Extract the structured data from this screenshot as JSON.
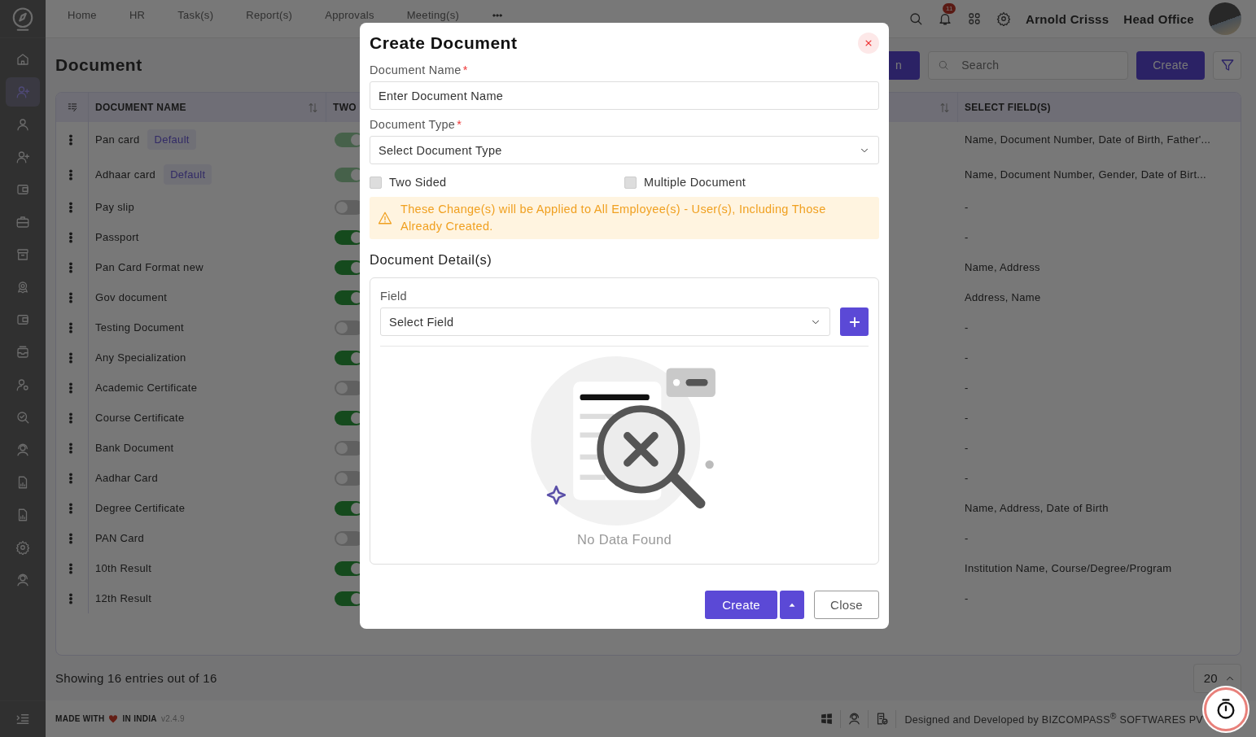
{
  "sidebar": {
    "items": [
      {
        "selected": false
      },
      {
        "selected": true
      },
      {
        "selected": false
      },
      {
        "selected": false
      },
      {
        "selected": false
      },
      {
        "selected": false
      },
      {
        "selected": false
      },
      {
        "selected": false
      },
      {
        "selected": false
      },
      {
        "selected": false
      },
      {
        "selected": false
      },
      {
        "selected": false
      },
      {
        "selected": false
      },
      {
        "selected": false
      },
      {
        "selected": false
      },
      {
        "selected": false
      }
    ]
  },
  "topbar": {
    "nav": [
      "Home",
      "HR",
      "Task(s)",
      "Report(s)",
      "Approvals",
      "Meeting(s)"
    ],
    "notification_count": "11",
    "user_name": "Arnold Crisss",
    "office": "Head Office"
  },
  "page": {
    "title": "Document",
    "partial_button": "n",
    "search_placeholder": "Search",
    "create_button": "Create"
  },
  "table": {
    "columns": [
      "DOCUMENT NAME",
      "TWO",
      "SELECT FIELD(S)"
    ],
    "rows": [
      {
        "name": "Pan card",
        "tag": "Default",
        "on": true,
        "disabled": true,
        "fields": "Name, Document Number, Date of Birth, Father'..."
      },
      {
        "name": "Adhaar card",
        "tag": "Default",
        "on": true,
        "disabled": true,
        "fields": "Name, Document Number, Gender, Date of Birt..."
      },
      {
        "name": "Pay slip",
        "on": false,
        "disabled": false,
        "fields": "-"
      },
      {
        "name": "Passport",
        "on": true,
        "disabled": false,
        "fields": "-"
      },
      {
        "name": "Pan Card Format new",
        "on": true,
        "disabled": false,
        "fields": "Name, Address"
      },
      {
        "name": "Gov document",
        "on": true,
        "disabled": false,
        "fields": "Address, Name"
      },
      {
        "name": "Testing Document",
        "on": false,
        "disabled": false,
        "fields": "-"
      },
      {
        "name": "Any Specialization",
        "on": true,
        "disabled": false,
        "fields": "-"
      },
      {
        "name": "Academic Certificate",
        "on": false,
        "disabled": false,
        "fields": "-"
      },
      {
        "name": "Course Certificate",
        "on": true,
        "disabled": false,
        "fields": "-"
      },
      {
        "name": "Bank Document",
        "on": false,
        "disabled": false,
        "fields": "-"
      },
      {
        "name": "Aadhar Card",
        "on": false,
        "disabled": false,
        "fields": "-"
      },
      {
        "name": "Degree Certificate",
        "on": true,
        "disabled": false,
        "fields": "Name, Address, Date of Birth"
      },
      {
        "name": "PAN Card",
        "on": false,
        "disabled": false,
        "fields": "-"
      },
      {
        "name": "10th Result",
        "on": true,
        "disabled": false,
        "fields": "Institution Name, Course/Degree/Program"
      },
      {
        "name": "12th Result",
        "on": true,
        "disabled": false,
        "fields": "-"
      }
    ]
  },
  "pagination": {
    "summary": "Showing 16 entries out of 16",
    "page_size": "20"
  },
  "footer": {
    "made_with": "MADE WITH",
    "in_india": "IN INDIA",
    "version": "v2.4.9",
    "credit": "Designed and Developed by  BIZCOMPASS$^{®}$ SOFTWARES PV"
  },
  "modal": {
    "title": "Create Document",
    "name_field": {
      "label": "Document Name",
      "required_mark": "*",
      "placeholder": "Enter Document Name"
    },
    "type_field": {
      "label": "Document Type",
      "required_mark": "*",
      "placeholder": "Select Document Type"
    },
    "checkboxes": [
      {
        "label": "Two Sided",
        "checked": false
      },
      {
        "label": "Multiple Document",
        "checked": false
      }
    ],
    "warning": "These Change(s) will be Applied to All Employee(s) - User(s), Including Those Already Created.",
    "section_title": "Document Detail(s)",
    "field_label": "Field",
    "field_placeholder": "Select Field",
    "empty_text": "No Data Found",
    "create_button": "Create",
    "close_button": "Close"
  }
}
